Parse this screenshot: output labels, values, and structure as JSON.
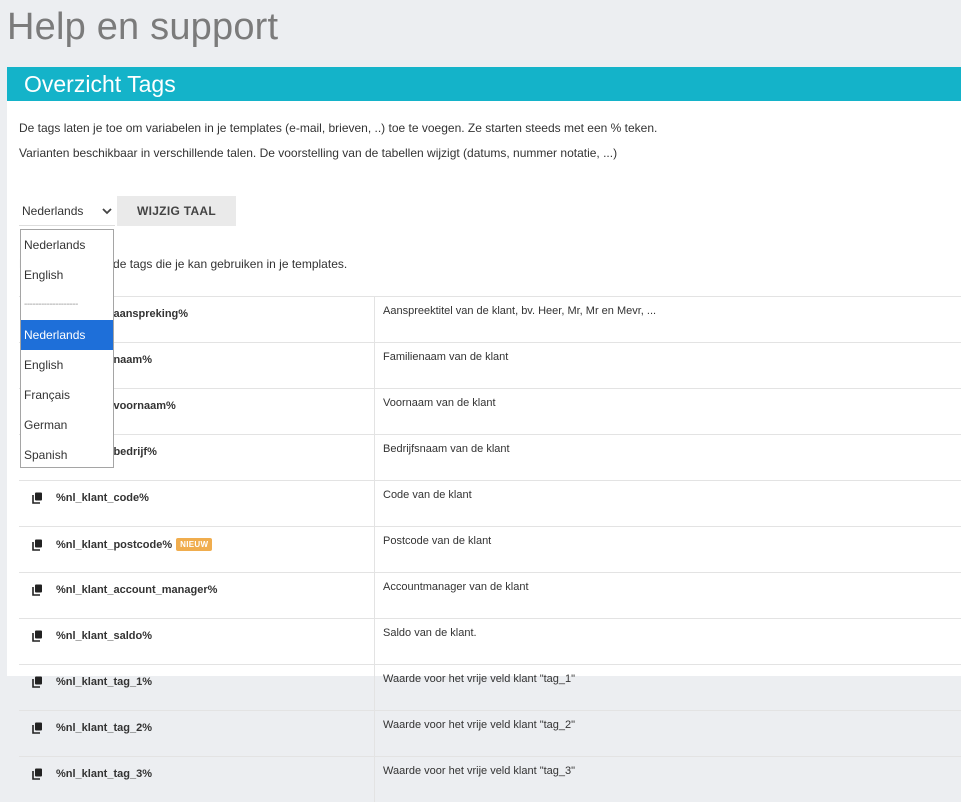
{
  "page_title": "Help en support",
  "panel": {
    "title": "Overzicht Tags",
    "intro": [
      "De tags laten je toe om variabelen in je templates (e-mail, brieven, ..) toe te voegen. Ze starten steeds met een % teken.",
      "Varianten beschikbaar in verschillende talen. De voorstelling van de tabellen wijzigt (datums, nummer notatie, ...)"
    ],
    "language_select": {
      "value": "Nederlands"
    },
    "change_button": "WIJZIG TAAL",
    "tags_intro": "Hieronder vind je de tags die je kan gebruiken in je templates.",
    "new_badge": "NIEUW",
    "tags": [
      {
        "tag": "%nl_klant_aanspreking%",
        "desc": "Aanspreektitel van de klant, bv. Heer, Mr, Mr en Mevr, ...",
        "new": false
      },
      {
        "tag": "%nl_klant_naam%",
        "desc": "Familienaam van de klant",
        "new": false
      },
      {
        "tag": "%nl_klant_voornaam%",
        "desc": "Voornaam van de klant",
        "new": false
      },
      {
        "tag": "%nl_klant_bedrijf%",
        "desc": "Bedrijfsnaam van de klant",
        "new": false
      },
      {
        "tag": "%nl_klant_code%",
        "desc": "Code van de klant",
        "new": false
      },
      {
        "tag": "%nl_klant_postcode%",
        "desc": "Postcode van de klant",
        "new": true
      },
      {
        "tag": "%nl_klant_account_manager%",
        "desc": "Accountmanager van de klant",
        "new": false
      },
      {
        "tag": "%nl_klant_saldo%",
        "desc": "Saldo van de klant.",
        "new": false
      },
      {
        "tag": "%nl_klant_tag_1%",
        "desc": "Waarde voor het vrije veld klant \"tag_1\"",
        "new": false
      },
      {
        "tag": "%nl_klant_tag_2%",
        "desc": "Waarde voor het vrije veld klant \"tag_2\"",
        "new": false
      },
      {
        "tag": "%nl_klant_tag_3%",
        "desc": "Waarde voor het vrije veld klant \"tag_3\"",
        "new": false
      }
    ]
  },
  "dropdown": {
    "options": [
      "Nederlands",
      "English",
      "-------------------",
      "Nederlands",
      "English",
      "Français",
      "German",
      "Spanish"
    ],
    "selected_index": 3
  },
  "icons": {
    "copy": "copy-icon",
    "chevron": "chevron-down-icon"
  },
  "colors": {
    "header": "#14b3c9",
    "selected": "#1e6fd9",
    "badge": "#f0ad4e"
  }
}
